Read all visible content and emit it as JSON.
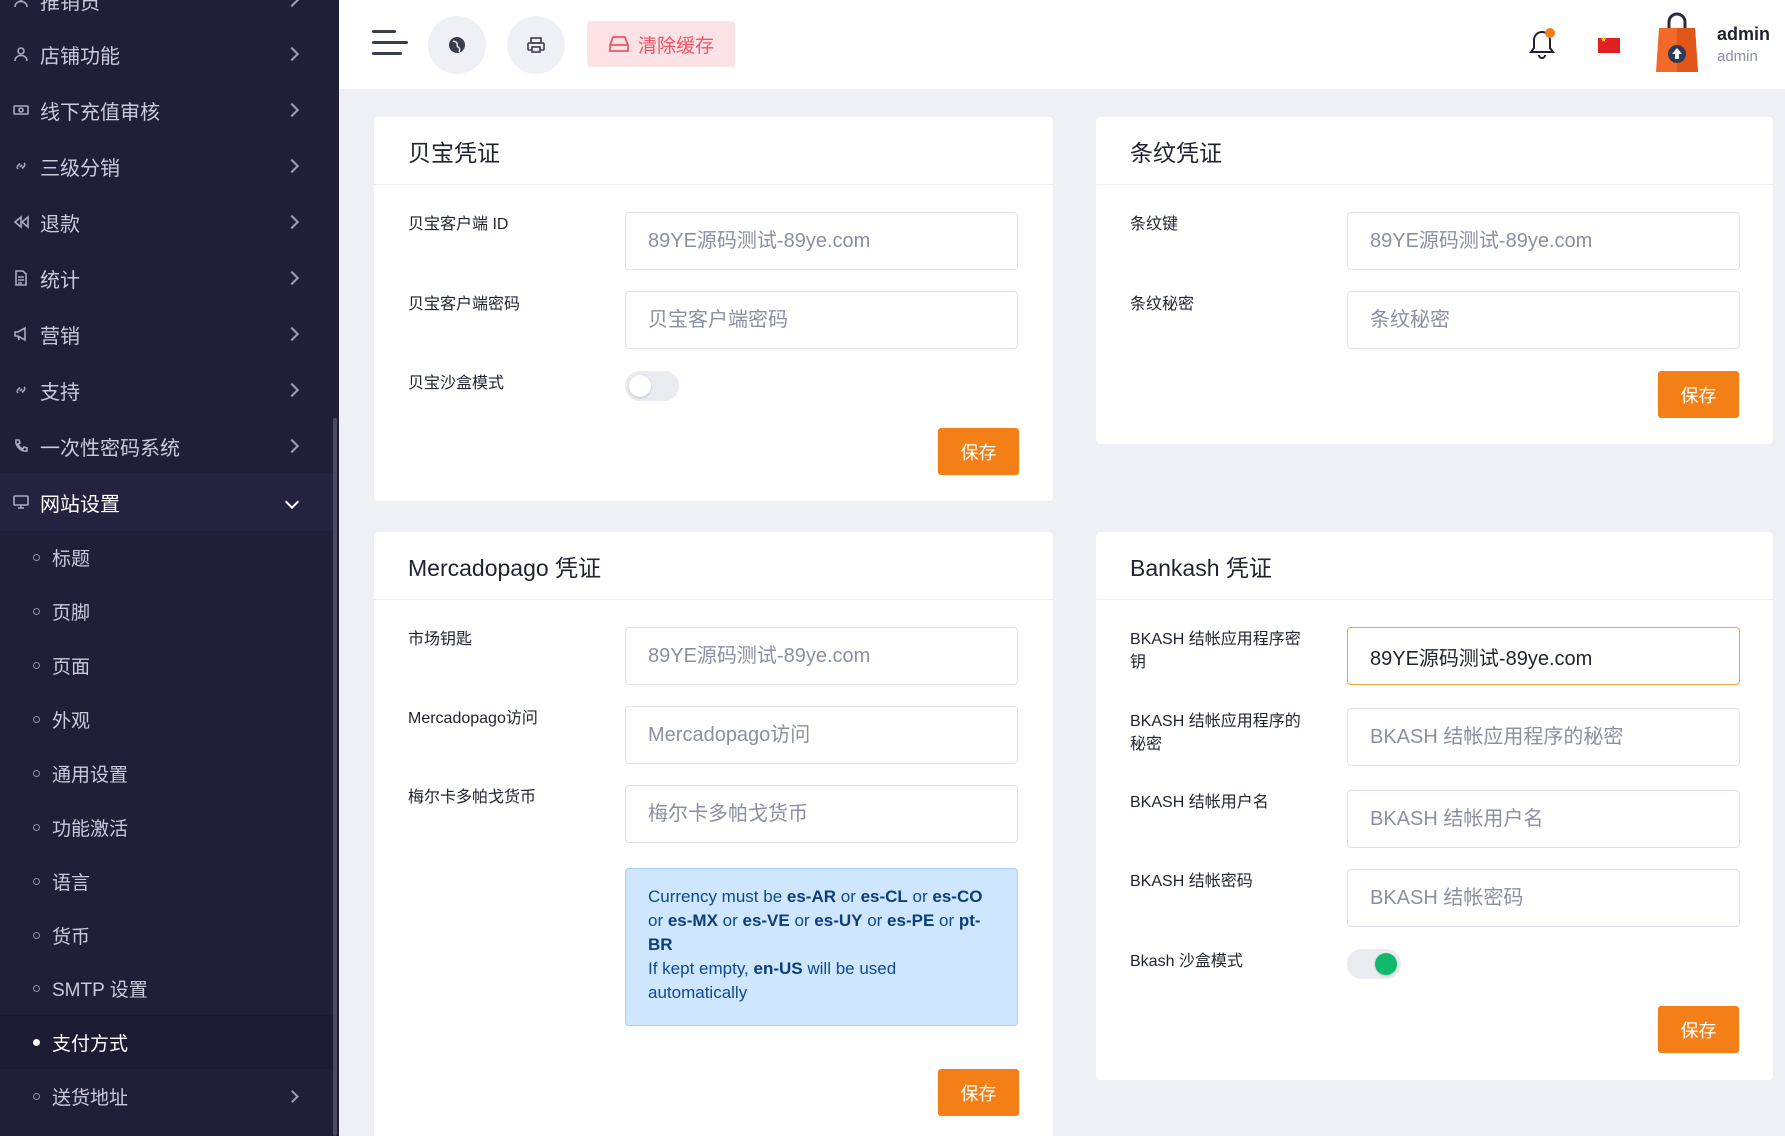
{
  "sidebar": {
    "items": [
      {
        "label": "推销员",
        "icon": "person-icon"
      },
      {
        "label": "店铺功能",
        "icon": "person-icon"
      },
      {
        "label": "线下充值审核",
        "icon": "cash-icon"
      },
      {
        "label": "三级分销",
        "icon": "link-icon"
      },
      {
        "label": "退款",
        "icon": "rewind-icon"
      },
      {
        "label": "统计",
        "icon": "document-icon"
      },
      {
        "label": "营销",
        "icon": "megaphone-icon"
      },
      {
        "label": "支持",
        "icon": "link-icon"
      },
      {
        "label": "一次性密码系统",
        "icon": "phone-icon"
      },
      {
        "label": "网站设置",
        "icon": "monitor-icon"
      }
    ],
    "sub_items": [
      "标题",
      "页脚",
      "页面",
      "外观",
      "通用设置",
      "功能激活",
      "语言",
      "货币",
      "SMTP 设置",
      "支付方式",
      "送货地址"
    ]
  },
  "topbar": {
    "clear_cache": "清除缓存",
    "user_name": "admin",
    "user_role": "admin"
  },
  "cards": {
    "paypal": {
      "title": "贝宝凭证",
      "client_id_label": "贝宝客户端 ID",
      "client_id_placeholder": "89YE源码测试-89ye.com",
      "client_secret_label": "贝宝客户端密码",
      "client_secret_placeholder": "贝宝客户端密码",
      "sandbox_label": "贝宝沙盒模式",
      "sandbox_on": false,
      "save": "保存"
    },
    "stripe": {
      "title": "条纹凭证",
      "key_label": "条纹键",
      "key_placeholder": "89YE源码测试-89ye.com",
      "secret_label": "条纹秘密",
      "secret_placeholder": "条纹秘密",
      "save": "保存"
    },
    "mercadopago": {
      "title": "Mercadopago 凭证",
      "market_key_label": "市场钥匙",
      "market_key_placeholder": "89YE源码测试-89ye.com",
      "access_label": "Mercadopago访问",
      "access_placeholder": "Mercadopago访问",
      "currency_label": "梅尔卡多帕戈货币",
      "currency_placeholder": "梅尔卡多帕戈货币",
      "info": {
        "p1": "Currency must be ",
        "c1": "es-AR",
        "or": " or ",
        "c2": "es-CL",
        "c3": "es-CO",
        "c4": "es-MX",
        "c5": "es-VE",
        "c6": "es-UY",
        "c7": "es-PE",
        "c8": "pt-BR",
        "p2": "If kept empty, ",
        "c9": "en-US",
        "p3": " will be used automatically"
      },
      "save": "保存"
    },
    "bkash": {
      "title": "Bankash 凭证",
      "app_key_label": "BKASH 结帐应用程序密钥",
      "app_key_value": "89YE源码测试-89ye.com",
      "app_secret_label": "BKASH 结帐应用程序的秘密",
      "app_secret_placeholder": "BKASH 结帐应用程序的秘密",
      "username_label": "BKASH 结帐用户名",
      "username_placeholder": "BKASH 结帐用户名",
      "password_label": "BKASH 结帐密码",
      "password_placeholder": "BKASH 结帐密码",
      "sandbox_label": "Bkash 沙盒模式",
      "sandbox_on": true,
      "save": "保存"
    }
  },
  "colors": {
    "sidebar_bg": "#1f1f38",
    "accent": "#f37f16",
    "toggle_on": "#10b96a",
    "clear_cache_text": "#ee5566"
  }
}
